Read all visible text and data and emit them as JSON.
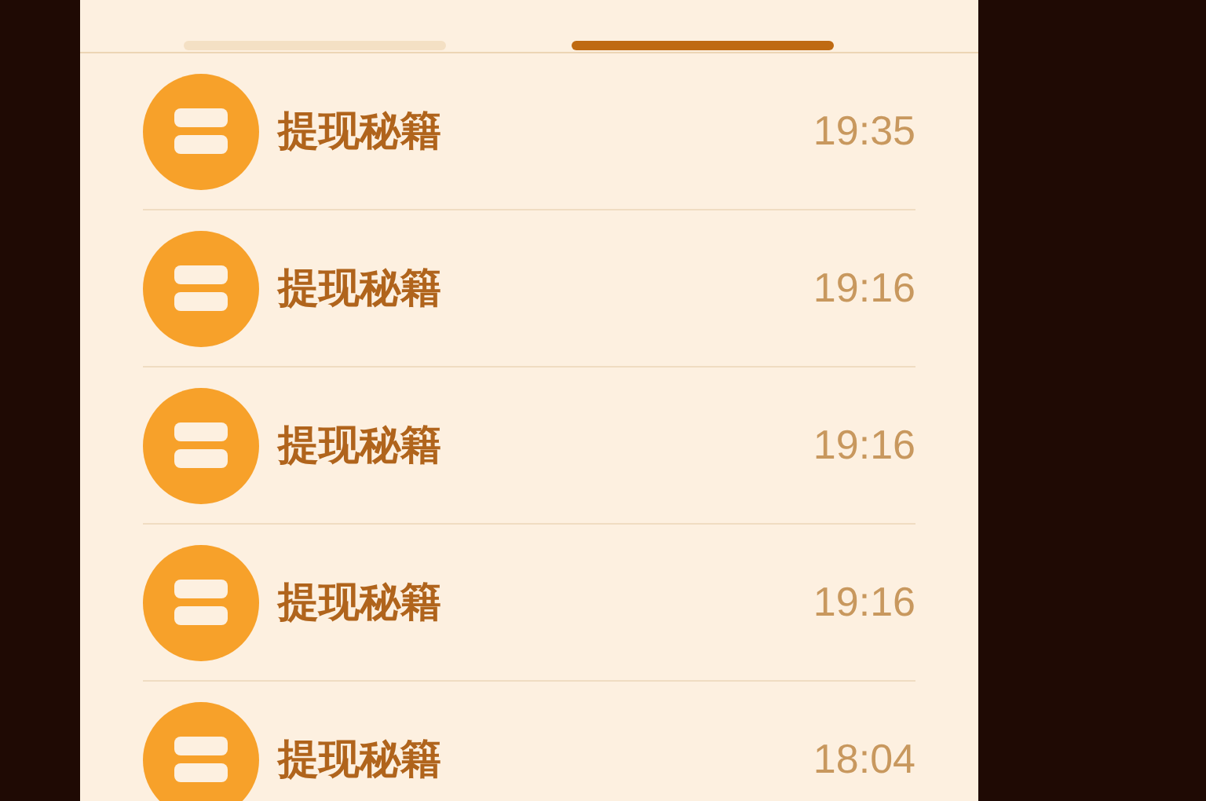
{
  "tabs": [
    {
      "selected": false
    },
    {
      "selected": true
    }
  ],
  "items": [
    {
      "title": "提现秘籍",
      "time": "19:35"
    },
    {
      "title": "提现秘籍",
      "time": "19:16"
    },
    {
      "title": "提现秘籍",
      "time": "19:16"
    },
    {
      "title": "提现秘籍",
      "time": "19:16"
    },
    {
      "title": "提现秘籍",
      "time": "18:04"
    }
  ]
}
